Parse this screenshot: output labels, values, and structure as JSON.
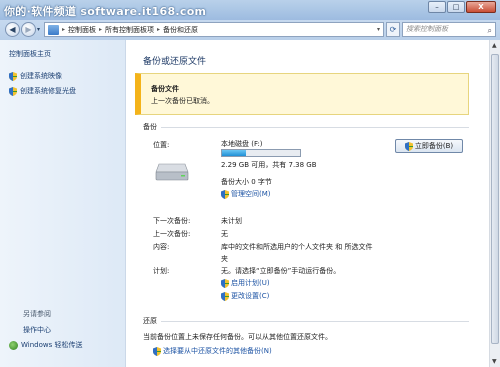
{
  "watermark": "你的·软件频道 software.it168.com",
  "window_buttons": {
    "minimize": "–",
    "maximize": "□",
    "close": "X"
  },
  "address": {
    "segments": [
      "控制面板",
      "所有控制面板项",
      "备份和还原"
    ],
    "separator": "▸",
    "search_placeholder": "搜索控制面板"
  },
  "sidebar": {
    "home": "控制面板主页",
    "links": [
      "创建系统映像",
      "创建系统修复光盘"
    ],
    "see_also": "另请参阅",
    "see_also_links": [
      "操作中心",
      "Windows 轻松传送"
    ]
  },
  "main": {
    "title": "备份或还原文件",
    "notice": {
      "title": "备份文件",
      "message": "上一次备份已取消。"
    },
    "backup_section": "备份",
    "location_label": "位置:",
    "drive_name": "本地磁盘 (F:)",
    "drive_usage_fraction": 0.31,
    "drive_space": "2.29 GB 可用，共有 7.38 GB",
    "backup_size": "备份大小 0 字节",
    "manage_space": "管理空间(M)",
    "backup_now_button": "立即备份(B)",
    "next_backup_label": "下一次备份:",
    "next_backup_value": "未计划",
    "last_backup_label": "上一次备份:",
    "last_backup_value": "无",
    "contents_label": "内容:",
    "contents_value_line1": "库中的文件和所选用户的个人文件夹 和 所选文件",
    "contents_value_line2": "夹",
    "schedule_label": "计划:",
    "schedule_value": "无。请选择“立即备份”手动运行备份。",
    "enable_schedule": "启用计划(U)",
    "change_settings": "更改设置(C)",
    "restore_section": "还原",
    "restore_text": "当前备份位置上未保存任何备份。可以从其他位置还原文件。",
    "restore_link": "选择要从中还原文件的其他备份(N)"
  },
  "colors": {
    "accent_link": "#1b52a3",
    "notice_bar": "#f4b31a",
    "progress": "#1f8fd6"
  }
}
